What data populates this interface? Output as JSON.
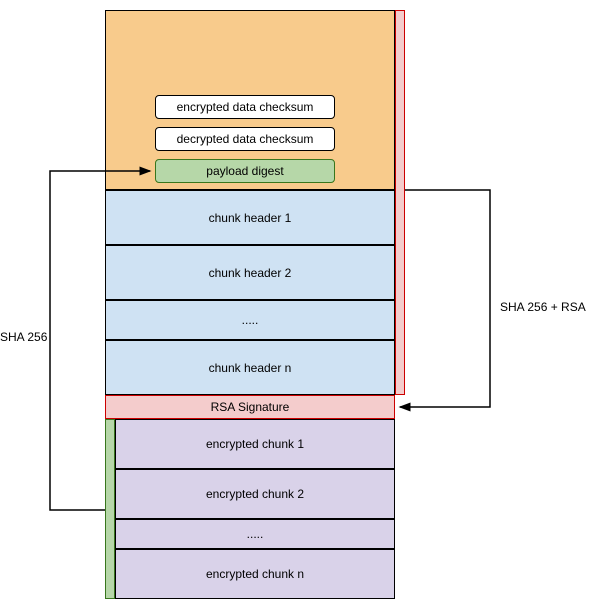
{
  "orange_header": {
    "encrypted_checksum": "encrypted data checksum",
    "decrypted_checksum": "decrypted data checksum",
    "payload_digest": "payload digest"
  },
  "chunk_headers": {
    "h1": "chunk header 1",
    "h2": "chunk header 2",
    "dots": ".....",
    "hn": "chunk header n"
  },
  "rsa_signature": "RSA Signature",
  "encrypted_chunks": {
    "c1": "encrypted chunk 1",
    "c2": "encrypted chunk 2",
    "dots": ".....",
    "cn": "encrypted chunk n"
  },
  "labels": {
    "sha256": "SHA 256",
    "sha256_rsa": "SHA 256 + RSA"
  },
  "colors": {
    "orange": "#f8cb8c",
    "blue": "#cfe2f3",
    "red": "#f4cccc",
    "green": "#b6d7a8",
    "purple": "#d9d2e9",
    "white": "#ffffff"
  }
}
